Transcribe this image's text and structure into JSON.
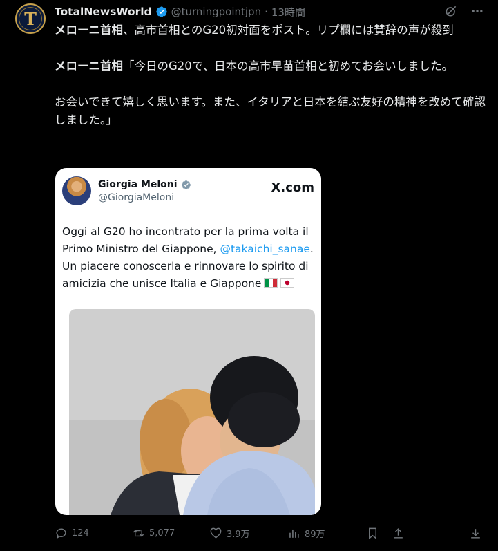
{
  "author": {
    "display_name": "TotalNewsWorld",
    "handle": "@turningpointjpn",
    "time": "13時間",
    "avatar_letter": "T"
  },
  "tweet": {
    "paragraphs": [
      {
        "bold": "メローニ首相",
        "text": "、高市首相とのG20初対面をポスト。リプ欄には賛辞の声が殺到"
      },
      {
        "bold": "メローニ首相",
        "text": "「今日のG20で、日本の高市早苗首相と初めてお会いしました。"
      },
      {
        "bold": "",
        "text": "お会いできて嬉しく思います。また、イタリアと日本を結ぶ友好の精神を改めて確認しました。」"
      }
    ]
  },
  "quoted": {
    "name": "Giorgia Meloni",
    "handle": "@GiorgiaMeloni",
    "brand": "X.com",
    "text_before": "Oggi al G20 ho incontrato per la prima volta il Primo Ministro del Giappone, ",
    "mention": "@takaichi_sanae",
    "text_after": ". Un piacere conoscerla e rinnovare lo spirito di amicizia che unisce Italia e Giappone"
  },
  "actions": {
    "replies": "124",
    "reposts": "5,077",
    "likes": "3.9万",
    "views": "89万"
  },
  "colors": {
    "background": "#000000",
    "text": "#e7e9ea",
    "muted": "#71767b",
    "verified": "#1d9bf0",
    "mention": "#1d9bf0"
  },
  "icons": [
    "verified-badge-icon",
    "grok-icon",
    "more-icon",
    "reply-icon",
    "repost-icon",
    "like-icon",
    "views-icon",
    "bookmark-icon",
    "share-icon",
    "download-icon"
  ]
}
